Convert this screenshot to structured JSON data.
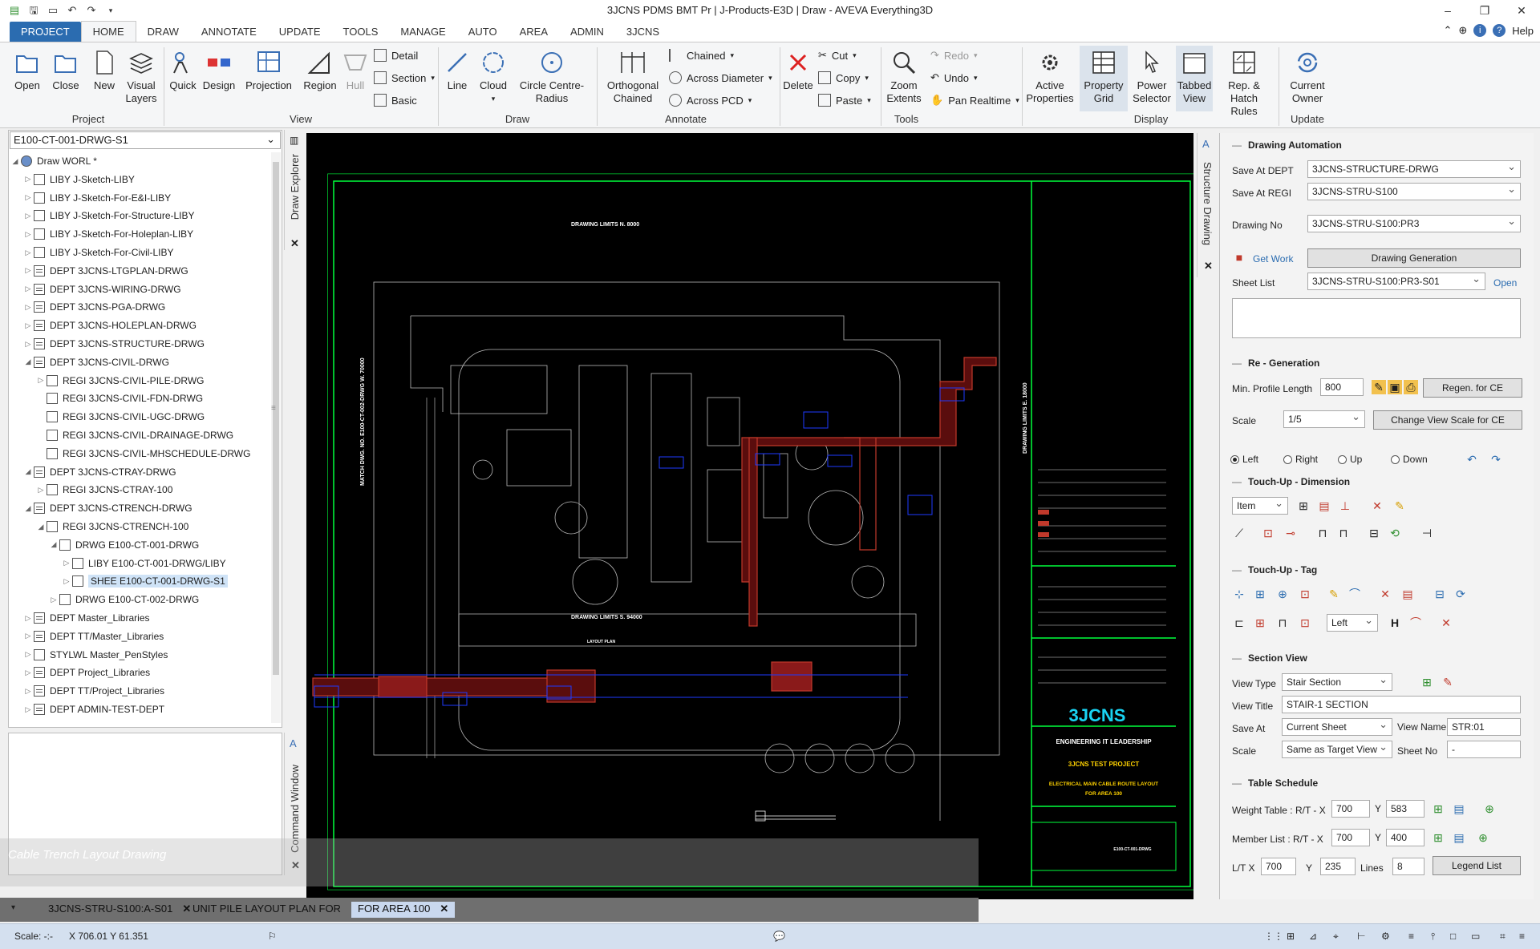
{
  "window": {
    "title": "3JCNS PDMS BMT Pr | J-Products-E3D | Draw - AVEVA Everything3D",
    "help_label": "Help"
  },
  "ribbon_tabs": [
    "PROJECT",
    "HOME",
    "DRAW",
    "ANNOTATE",
    "UPDATE",
    "TOOLS",
    "MANAGE",
    "AUTO",
    "AREA",
    "ADMIN",
    "3JCNS"
  ],
  "ribbon": {
    "project": {
      "group": "Project",
      "open": "Open",
      "close": "Close",
      "new": "New",
      "visual_layers": "Visual Layers"
    },
    "view": {
      "group": "View",
      "quick": "Quick",
      "design": "Design",
      "projection": "Projection",
      "region": "Region",
      "hull": "Hull",
      "detail": "Detail",
      "section": "Section",
      "basic": "Basic"
    },
    "draw": {
      "group": "Draw",
      "line": "Line",
      "cloud": "Cloud",
      "circle": "Circle Centre-Radius"
    },
    "annotate": {
      "group": "Annotate",
      "orth": "Orthogonal Chained",
      "chained": "Chained",
      "across_diameter": "Across Diameter",
      "across_pcd": "Across PCD"
    },
    "edit": {
      "delete": "Delete",
      "cut": "Cut",
      "copy": "Copy",
      "paste": "Paste"
    },
    "tools": {
      "group": "Tools",
      "zoom": "Zoom Extents",
      "redo": "Redo",
      "undo": "Undo",
      "pan": "Pan Realtime"
    },
    "display": {
      "group": "Display",
      "active": "Active Properties",
      "property_grid": "Property Grid",
      "power": "Power Selector",
      "tabbed": "Tabbed View",
      "rep": "Rep. & Hatch Rules"
    },
    "update": {
      "group": "Update",
      "owner": "Current Owner"
    }
  },
  "explorer": {
    "selector": "E100-CT-001-DRWG-S1",
    "panel_label": "Draw Explorer",
    "items": [
      {
        "label": "Draw WORL *",
        "indent": 0,
        "exp": "◢",
        "type": "world"
      },
      {
        "label": "LIBY J-Sketch-LIBY",
        "indent": 1,
        "exp": "▷",
        "type": "doc"
      },
      {
        "label": "LIBY J-Sketch-For-E&I-LIBY",
        "indent": 1,
        "exp": "▷",
        "type": "doc"
      },
      {
        "label": "LIBY J-Sketch-For-Structure-LIBY",
        "indent": 1,
        "exp": "▷",
        "type": "doc"
      },
      {
        "label": "LIBY J-Sketch-For-Holeplan-LIBY",
        "indent": 1,
        "exp": "▷",
        "type": "doc"
      },
      {
        "label": "LIBY J-Sketch-For-Civil-LIBY",
        "indent": 1,
        "exp": "▷",
        "type": "doc"
      },
      {
        "label": "DEPT 3JCNS-LTGPLAN-DRWG",
        "indent": 1,
        "exp": "▷",
        "type": "dept"
      },
      {
        "label": "DEPT 3JCNS-WIRING-DRWG",
        "indent": 1,
        "exp": "▷",
        "type": "dept"
      },
      {
        "label": "DEPT 3JCNS-PGA-DRWG",
        "indent": 1,
        "exp": "▷",
        "type": "dept"
      },
      {
        "label": "DEPT 3JCNS-HOLEPLAN-DRWG",
        "indent": 1,
        "exp": "▷",
        "type": "dept"
      },
      {
        "label": "DEPT 3JCNS-STRUCTURE-DRWG",
        "indent": 1,
        "exp": "▷",
        "type": "dept"
      },
      {
        "label": "DEPT 3JCNS-CIVIL-DRWG",
        "indent": 1,
        "exp": "◢",
        "type": "dept"
      },
      {
        "label": "REGI 3JCNS-CIVIL-PILE-DRWG",
        "indent": 2,
        "exp": "▷",
        "type": "regi"
      },
      {
        "label": "REGI 3JCNS-CIVIL-FDN-DRWG",
        "indent": 2,
        "exp": "",
        "type": "regi"
      },
      {
        "label": "REGI 3JCNS-CIVIL-UGC-DRWG",
        "indent": 2,
        "exp": "",
        "type": "regi"
      },
      {
        "label": "REGI 3JCNS-CIVIL-DRAINAGE-DRWG",
        "indent": 2,
        "exp": "",
        "type": "regi"
      },
      {
        "label": "REGI 3JCNS-CIVIL-MHSCHEDULE-DRWG",
        "indent": 2,
        "exp": "",
        "type": "regi"
      },
      {
        "label": "DEPT 3JCNS-CTRAY-DRWG",
        "indent": 1,
        "exp": "◢",
        "type": "dept"
      },
      {
        "label": "REGI 3JCNS-CTRAY-100",
        "indent": 2,
        "exp": "▷",
        "type": "regi"
      },
      {
        "label": "DEPT 3JCNS-CTRENCH-DRWG",
        "indent": 1,
        "exp": "◢",
        "type": "dept"
      },
      {
        "label": "REGI 3JCNS-CTRENCH-100",
        "indent": 2,
        "exp": "◢",
        "type": "regi"
      },
      {
        "label": "DRWG E100-CT-001-DRWG",
        "indent": 3,
        "exp": "◢",
        "type": "drwg"
      },
      {
        "label": "LIBY E100-CT-001-DRWG/LIBY",
        "indent": 4,
        "exp": "▷",
        "type": "doc"
      },
      {
        "label": "SHEE E100-CT-001-DRWG-S1",
        "indent": 4,
        "exp": "▷",
        "type": "doc",
        "selected": true
      },
      {
        "label": "DRWG E100-CT-002-DRWG",
        "indent": 3,
        "exp": "▷",
        "type": "drwg"
      },
      {
        "label": "DEPT Master_Libraries",
        "indent": 1,
        "exp": "▷",
        "type": "dept"
      },
      {
        "label": "DEPT TT/Master_Libraries",
        "indent": 1,
        "exp": "▷",
        "type": "dept"
      },
      {
        "label": "STYLWL Master_PenStyles",
        "indent": 1,
        "exp": "▷",
        "type": "doc"
      },
      {
        "label": "DEPT Project_Libraries",
        "indent": 1,
        "exp": "▷",
        "type": "dept"
      },
      {
        "label": "DEPT TT/Project_Libraries",
        "indent": 1,
        "exp": "▷",
        "type": "dept"
      },
      {
        "label": "DEPT ADMIN-TEST-DEPT",
        "indent": 1,
        "exp": "▷",
        "type": "dept"
      }
    ]
  },
  "command_window_label": "Command Window",
  "caption": "Cable Trench Layout Drawing",
  "drawing": {
    "limits_n": "DRAWING LIMITS N. 8000",
    "limits_s": "DRAWING LIMITS S. 94000",
    "limits_e": "DRAWING LIMITS E. 18000",
    "match": "MATCH DWG. NO. E100-CT-002-DRWG W. 70000",
    "layout": "LAYOUT PLAN",
    "brand": "3JCNS",
    "tagline": "ENGINEERING IT LEADERSHIP",
    "project": "3JCNS TEST PROJECT",
    "title1": "ELECTRICAL MAIN CABLE ROUTE LAYOUT",
    "title2": "FOR AREA 100",
    "dwg_no": "E100-CT-001-DRWG"
  },
  "side_label": "Structure Drawing",
  "panel": {
    "drawing_automation": "Drawing Automation",
    "save_at_dept_label": "Save At DEPT",
    "save_at_dept": "3JCNS-STRUCTURE-DRWG",
    "save_at_regi_label": "Save At REGI",
    "save_at_regi": "3JCNS-STRU-S100",
    "drawing_no_label": "Drawing No",
    "drawing_no": "3JCNS-STRU-S100:PR3",
    "get_work": "Get Work",
    "drawing_generation": "Drawing Generation",
    "sheet_list_label": "Sheet List",
    "sheet_list": "3JCNS-STRU-S100:PR3-S01",
    "open": "Open",
    "regeneration": "Re - Generation",
    "min_profile_label": "Min. Profile Length",
    "min_profile": "800",
    "regen_btn": "Regen. for CE",
    "scale_label": "Scale",
    "scale": "1/5",
    "change_scale_btn": "Change View Scale for CE",
    "dir_left": "Left",
    "dir_right": "Right",
    "dir_up": "Up",
    "dir_down": "Down",
    "touchup_dim": "Touch-Up - Dimension",
    "item": "Item",
    "touchup_tag": "Touch-Up - Tag",
    "tag_left": "Left",
    "section_view": "Section View",
    "view_type_label": "View Type",
    "view_type": "Stair Section",
    "view_title_label": "View Title",
    "view_title": "STAIR-1 SECTION",
    "save_at_label": "Save At",
    "save_at": "Current Sheet",
    "view_name_label": "View Name",
    "view_name": "STR:01",
    "scale2_label": "Scale",
    "scale2": "Same as Target View",
    "sheet_no_label": "Sheet No",
    "sheet_no": "-",
    "table_schedule": "Table Schedule",
    "weight_label": "Weight Table : R/T - X",
    "weight_x": "700",
    "weight_y": "583",
    "member_label": "Member List : R/T - X",
    "member_x": "700",
    "member_y": "400",
    "lt_label": "L/T X",
    "lt_x": "700",
    "lt_y": "235",
    "lines_label": "Lines",
    "lines": "8",
    "legend_btn": "Legend List",
    "y_label": "Y"
  },
  "doc_tabs": [
    "3JCNS-STRU-S100:A-S01",
    "UNIT PILE LAYOUT PLAN FOR",
    "FOR AREA 100"
  ],
  "status": {
    "scale": "Scale: -:-",
    "coords": "X 706.01 Y 61.351"
  },
  "colors": {
    "accent": "#2b6cb0",
    "canvas": "#000000",
    "frame": "#00ff3c",
    "trench": "#c0392b",
    "cable": "#1e3aff"
  }
}
